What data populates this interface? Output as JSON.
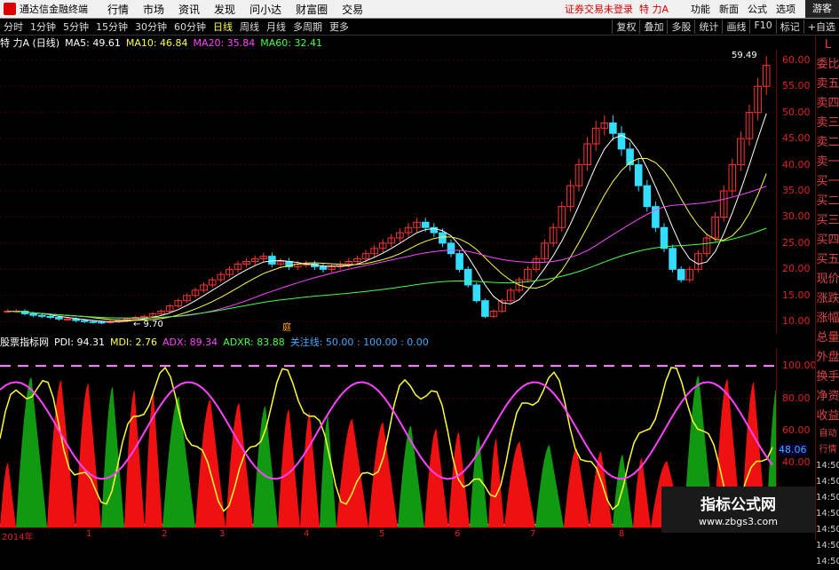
{
  "menubar": {
    "app_title": "通达信金融终端",
    "items": [
      "行情",
      "市场",
      "资讯",
      "发现",
      "问小达",
      "财富圈",
      "交易"
    ],
    "status": "证券交易未登录",
    "stock": "特 力A",
    "right_items": [
      "功能",
      "新面",
      "公式",
      "选项"
    ],
    "guest": "游客"
  },
  "toolbar": {
    "periods": [
      "分时",
      "1分钟",
      "5分钟",
      "15分钟",
      "30分钟",
      "60分钟",
      "日线",
      "周线",
      "月线",
      "多周期",
      "更多"
    ],
    "active": "日线",
    "right": [
      "复权",
      "叠加",
      "多股",
      "统计",
      "画线",
      "F10",
      "标记",
      "+自选"
    ]
  },
  "price_panel": {
    "title": "特 力A (日线)",
    "ma": [
      {
        "label": "MA5: 49.61",
        "color": "#ffffff"
      },
      {
        "label": "MA10: 46.84",
        "color": "#ffff44"
      },
      {
        "label": "MA20: 35.84",
        "color": "#ff44ff"
      },
      {
        "label": "MA60: 32.41",
        "color": "#44ff44"
      }
    ],
    "high_label": "59.49",
    "low_label": "9.70",
    "axis": [
      "60.00",
      "55.00",
      "50.00",
      "45.00",
      "40.00",
      "35.00",
      "30.00",
      "25.00",
      "20.00",
      "15.00",
      "10.00"
    ],
    "event_marker": "庭"
  },
  "indicator_panel": {
    "title": "股票指标网",
    "fields": [
      {
        "label": "PDI: 94.31",
        "color": "#ffffff"
      },
      {
        "label": "MDI: 2.76",
        "color": "#ffff44"
      },
      {
        "label": "ADX: 89.34",
        "color": "#ff44ff"
      },
      {
        "label": "ADXR: 83.88",
        "color": "#44ff44"
      },
      {
        "label": "关注线: 50.00 : 100.00 : 0.00",
        "color": "#44aaff"
      }
    ],
    "axis": [
      "100.00",
      "80.00",
      "60.00",
      "40.00"
    ],
    "current": "48.06"
  },
  "xaxis": {
    "labels": [
      "2014年",
      "1",
      "2",
      "3",
      "4",
      "5",
      "6",
      "7",
      "8"
    ]
  },
  "sidebar": {
    "top": "L",
    "items": [
      "委比",
      "卖五",
      "卖四",
      "卖三",
      "卖二",
      "卖一",
      "买一",
      "买二",
      "买三",
      "买四",
      "买五",
      "现价",
      "涨跌",
      "涨幅",
      "总量",
      "外盘",
      "换手",
      "净资",
      "收益"
    ],
    "bottom": [
      "自动",
      "行情",
      "14:50",
      "14:50",
      "14:50",
      "14:50",
      "14:50",
      "14:50",
      "14:50"
    ]
  },
  "watermark": {
    "title": "指标公式网",
    "url": "www.zbgs3.com"
  },
  "chart_data": {
    "type": "candlestick",
    "ylim": [
      8,
      62
    ],
    "close": [
      12,
      12,
      11.5,
      11.2,
      11,
      10.8,
      10.5,
      10.5,
      10.2,
      10,
      9.9,
      9.8,
      10,
      10.2,
      10.5,
      10.8,
      11,
      11.5,
      12,
      13,
      14,
      15,
      16,
      17,
      18,
      19,
      20,
      21,
      21.5,
      22,
      22.5,
      21,
      21.5,
      20.5,
      21,
      21,
      20.5,
      20,
      20.5,
      21,
      21.5,
      22,
      23,
      24,
      25,
      26,
      27,
      28,
      29,
      28,
      27,
      25,
      23,
      20,
      17,
      14,
      11,
      12,
      14,
      16,
      18,
      20,
      22,
      25,
      28,
      32,
      36,
      40,
      44,
      47,
      48,
      46,
      43,
      40,
      36,
      32,
      28,
      24,
      20,
      18,
      20,
      23,
      26,
      30,
      35,
      40,
      45,
      50,
      55,
      59
    ]
  }
}
